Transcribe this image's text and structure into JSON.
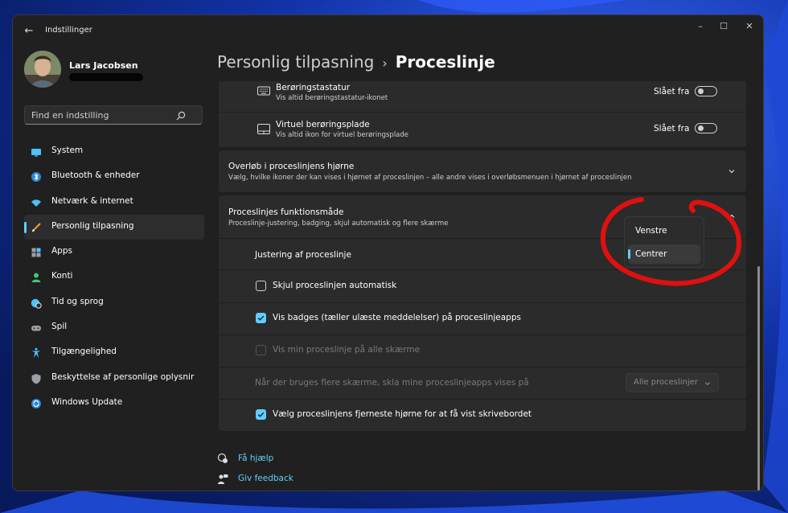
{
  "window": {
    "title": "Indstillinger",
    "back_glyph": "←",
    "controls": {
      "minimize": "–",
      "maximize": "☐",
      "close": "✕"
    }
  },
  "profile": {
    "name": "Lars Jacobsen"
  },
  "search": {
    "placeholder": "Find en indstilling",
    "icon": "search-icon"
  },
  "nav": {
    "items": [
      {
        "label": "System",
        "icon": "monitor-icon",
        "active": false
      },
      {
        "label": "Bluetooth & enheder",
        "icon": "bluetooth-icon",
        "active": false
      },
      {
        "label": "Netværk & internet",
        "icon": "wifi-icon",
        "active": false
      },
      {
        "label": "Personlig tilpasning",
        "icon": "paintbrush-icon",
        "active": true
      },
      {
        "label": "Apps",
        "icon": "apps-icon",
        "active": false
      },
      {
        "label": "Konti",
        "icon": "person-icon",
        "active": false
      },
      {
        "label": "Tid og sprog",
        "icon": "globe-clock-icon",
        "active": false
      },
      {
        "label": "Spil",
        "icon": "gamepad-icon",
        "active": false
      },
      {
        "label": "Tilgængelighed",
        "icon": "accessibility-icon",
        "active": false
      },
      {
        "label": "Beskyttelse af personlige oplysnir",
        "icon": "shield-icon",
        "active": false
      },
      {
        "label": "Windows Update",
        "icon": "update-icon",
        "active": false
      }
    ]
  },
  "breadcrumb": {
    "parent": "Personlig tilpasning",
    "separator": "›",
    "current": "Proceslinje"
  },
  "touch_keyboard": {
    "title": "Berøringstastatur",
    "subtitle": "Vis altid berøringstastatur-ikonet",
    "state_label": "Slået fra",
    "on": false
  },
  "touchpad": {
    "title": "Virtuel berøringsplade",
    "subtitle": "Vis altid ikon for virtuel berøringsplade",
    "state_label": "Slået fra",
    "on": false
  },
  "overflow": {
    "title": "Overløb i proceslinjens hjørne",
    "subtitle": "Vælg, hvilke ikoner der kan vises i hjørnet af proceslinjen – alle andre vises i overløbsmenuen i hjørnet af proceslinjen"
  },
  "behaviors": {
    "title": "Proceslinjes funktionsmåde",
    "subtitle": "Proceslinje-justering, badging, skjul automatisk og flere skærme",
    "alignment_label": "Justering af proceslinje",
    "alignment_options": [
      "Venstre",
      "Centrer"
    ],
    "alignment_selected": "Centrer",
    "checkboxes": [
      {
        "label": "Skjul proceslinjen automatisk",
        "checked": false,
        "disabled": false
      },
      {
        "label": "Vis badges (tæller ulæste meddelelser) på proceslinjeapps",
        "checked": true,
        "disabled": false
      },
      {
        "label": "Vis min proceslinje på alle skærme",
        "checked": false,
        "disabled": true
      }
    ],
    "multi_display_label": "Når der bruges flere skærme, skla mine proceslinjeapps vises på",
    "multi_display_value": "Alle proceslinjer",
    "desktop_corner": {
      "label": "Vælg proceslinjens fjerneste hjørne for at få vist skrivebordet",
      "checked": true
    }
  },
  "help": {
    "get_help": "Få hjælp",
    "give_feedback": "Giv feedback"
  },
  "colors": {
    "accent": "#60cdff",
    "annotation": "#e01010",
    "window_bg": "#202020",
    "card_bg": "#2b2b2b"
  }
}
